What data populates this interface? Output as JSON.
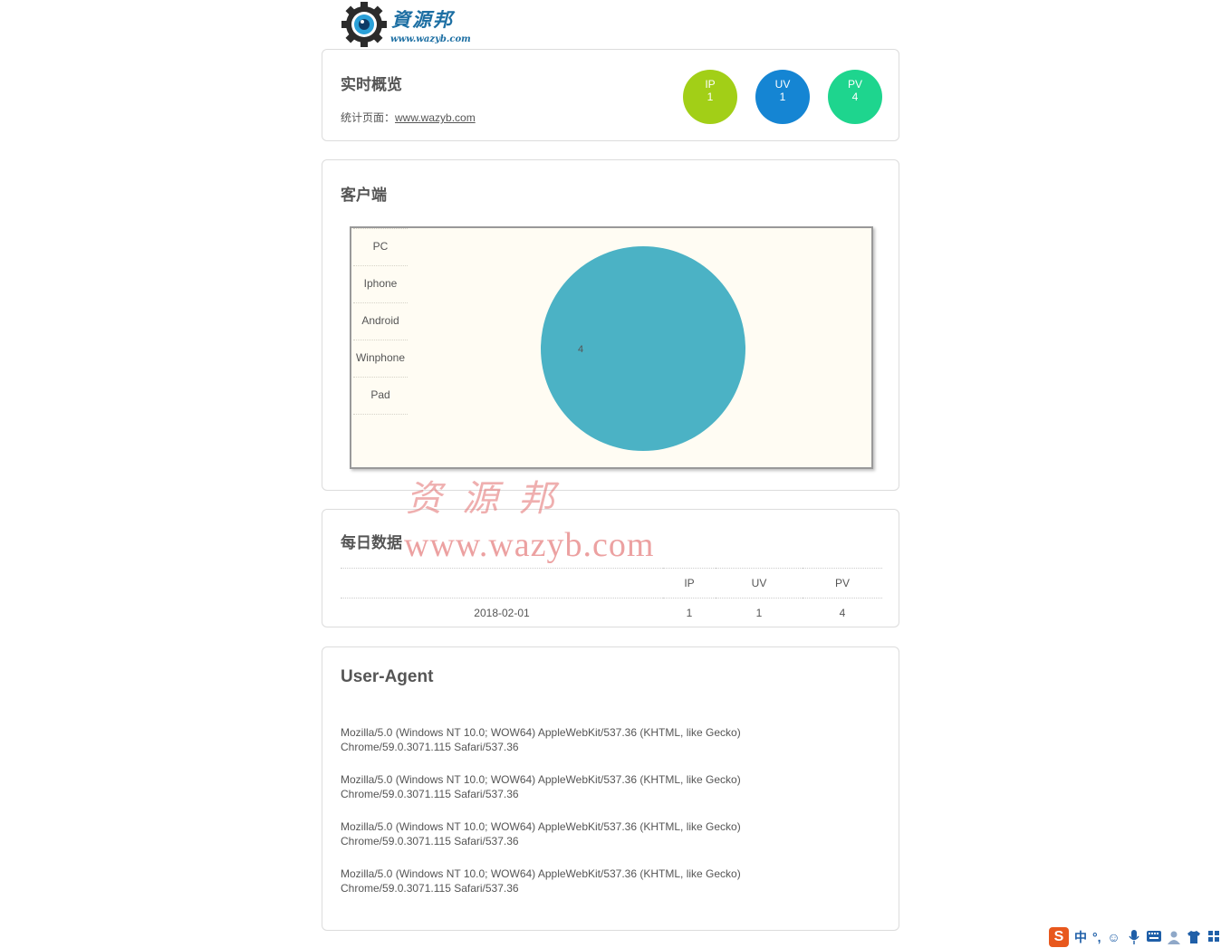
{
  "logo": {
    "text": "資源邦",
    "url": "www.wazyb.com"
  },
  "overview": {
    "title": "实时概览",
    "link_label": "统计页面：",
    "link_text": "www.wazyb.com",
    "stats": [
      {
        "label": "IP",
        "value": "1",
        "color": "#a2cf17"
      },
      {
        "label": "UV",
        "value": "1",
        "color": "#1585d3"
      },
      {
        "label": "PV",
        "value": "4",
        "color": "#1ed58e"
      }
    ]
  },
  "client": {
    "title": "客户端",
    "chart_data": {
      "type": "pie",
      "title": "",
      "categories": [
        "PC",
        "Iphone",
        "Android",
        "Winphone",
        "Pad"
      ],
      "values": [
        4,
        0,
        0,
        0,
        0
      ],
      "colors": [
        "#4bb2c5",
        "#c5b47f",
        "#eaa228",
        "#579575",
        "#839557"
      ],
      "legend": "left",
      "data_labels": [
        "4"
      ]
    }
  },
  "daily": {
    "title": "每日数据",
    "columns": [
      "",
      "IP",
      "UV",
      "PV"
    ],
    "rows": [
      {
        "date": "2018-02-01",
        "ip": "1",
        "uv": "1",
        "pv": "4"
      }
    ]
  },
  "user_agent": {
    "title": "User-Agent",
    "items": [
      {
        "line1": "Mozilla/5.0 (Windows NT 10.0; WOW64) AppleWebKit/537.36 (KHTML, like Gecko)",
        "line2": "Chrome/59.0.3071.115 Safari/537.36"
      },
      {
        "line1": "Mozilla/5.0 (Windows NT 10.0; WOW64) AppleWebKit/537.36 (KHTML, like Gecko)",
        "line2": "Chrome/59.0.3071.115 Safari/537.36"
      },
      {
        "line1": "Mozilla/5.0 (Windows NT 10.0; WOW64) AppleWebKit/537.36 (KHTML, like Gecko)",
        "line2": "Chrome/59.0.3071.115 Safari/537.36"
      },
      {
        "line1": "Mozilla/5.0 (Windows NT 10.0; WOW64) AppleWebKit/537.36 (KHTML, like Gecko)",
        "line2": "Chrome/59.0.3071.115 Safari/537.36"
      }
    ]
  },
  "watermark": {
    "cn": "资源邦",
    "url": "www.wazyb.com"
  },
  "tray": {
    "ime_logo": "S",
    "mode": "中",
    "punct": "°,",
    "icons": [
      "emoji-icon",
      "mic-icon",
      "keyboard-icon",
      "user-icon",
      "shirt-icon"
    ]
  }
}
